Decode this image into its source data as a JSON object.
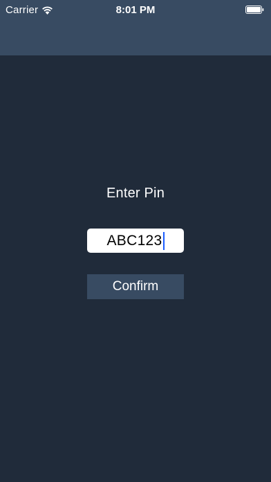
{
  "status_bar": {
    "carrier": "Carrier",
    "time": "8:01 PM",
    "wifi_icon": "wifi-icon",
    "battery_icon": "battery-icon"
  },
  "pin_screen": {
    "prompt": "Enter Pin",
    "input_value": "ABC123",
    "confirm_label": "Confirm"
  },
  "colors": {
    "background": "#202b3a",
    "navbar": "#384b62",
    "button": "#384b62",
    "caret": "#1a5cff"
  }
}
